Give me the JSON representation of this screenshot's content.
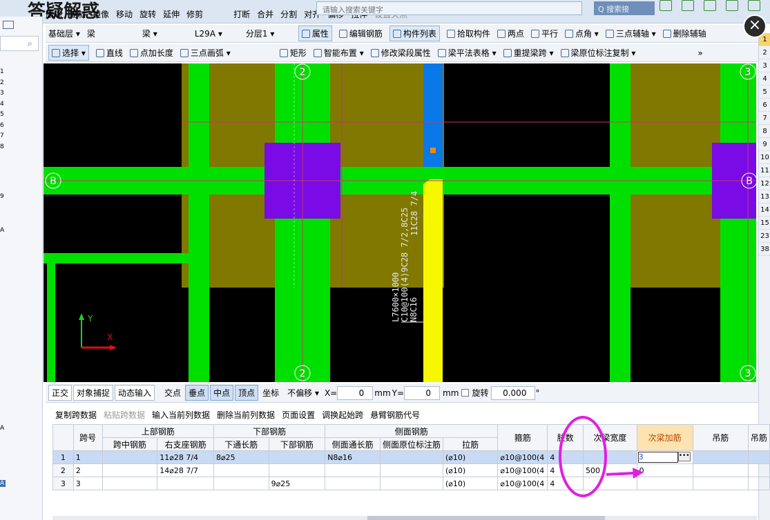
{
  "app": {
    "logo_text": "答疑解惑",
    "search_placeholder": "请输入搜索关键字",
    "search2_label": "Q 搜索接",
    "ribbon_items": [
      "删除",
      "复制",
      "镜像",
      "移动",
      "旋转",
      "延伸",
      "修剪",
      "打断",
      "合并",
      "分割",
      "对齐",
      "偏移",
      "拉伸",
      "设置夹点"
    ]
  },
  "left_panel": {
    "numbers": [
      "1",
      "2",
      "3",
      "4",
      "5",
      "6",
      "7",
      "8",
      "9",
      "A",
      "A",
      "A"
    ]
  },
  "right_panel": {
    "numbers": [
      "1",
      "2",
      "3",
      "4",
      "5",
      "6",
      "7",
      "8",
      "9",
      "10",
      "11",
      "12",
      "13",
      "14",
      "15",
      "23",
      "38"
    ]
  },
  "toolbar1": {
    "floor": "基础层",
    "type1": "梁",
    "type2": "梁",
    "element": "L29A",
    "layer": "分层1",
    "properties": "属性",
    "edit_rebar": "编辑钢筋",
    "component_list": "构件列表",
    "pick_component": "拾取构件",
    "two_points": "两点",
    "parallel": "平行",
    "point_angle": "点角",
    "three_point_axis": "三点辅轴",
    "delete_axis": "删除辅轴"
  },
  "toolbar2": {
    "select": "选择",
    "line": "直线",
    "point_length": "点加长度",
    "arc": "三点画弧",
    "rect": "矩形",
    "smart_layout": "智能布置",
    "modify_span": "修改梁段属性",
    "beam_table": "梁平法表格",
    "re_span": "重提梁跨",
    "copy_annot": "梁原位标注复制",
    "more": "»"
  },
  "canvas": {
    "axis_labels": [
      "2",
      "3",
      "B",
      "B",
      "2",
      "3"
    ],
    "annot_vertical1": "L7600×1000",
    "annot_vertical2": "C10@100(4)9C28 7/2,8C25",
    "annot_vertical3": "N8C16",
    "annot_vertical4": "11C28 7/4",
    "y_label": "Y",
    "x_label": "X",
    "colors": {
      "slab": "#807800",
      "beam": "#00e000",
      "column": "#7a0ae6",
      "selected_beam": "#f7f700",
      "blue_beam": "#0a78e6"
    }
  },
  "close_icon": "×",
  "snapbar": {
    "ortho": "正交",
    "snap": "对象捕捉",
    "dynamic": "动态输入",
    "intersect": "交点",
    "perpendicular": "垂点",
    "midpoint": "中点",
    "vertex": "顶点",
    "coordinate": "坐标",
    "offset": "不偏移",
    "x_label": "X=",
    "x_value": "0",
    "unit1": "mm",
    "y_label": "Y=",
    "y_value": "0",
    "unit2": "mm",
    "rotate": "旋转",
    "rotate_value": "0.000",
    "degree": "°"
  },
  "grid_toolbar": {
    "copy_span": "复制跨数据",
    "paste_span": "粘贴跨数据",
    "input_col": "输入当前列数据",
    "delete_col": "删除当前列数据",
    "page_setup": "页面设置",
    "swap_start": "调换起始跨",
    "cantilever": "悬臂钢筋代号"
  },
  "grid": {
    "group_headers": {
      "top": "上部钢筋",
      "bottom": "下部钢筋",
      "side": "侧面钢筋"
    },
    "headers": {
      "span_no": "跨号",
      "mid_span": "跨中钢筋",
      "right_support": "右支座钢筋",
      "bottom_through": "下通长筋",
      "bottom_bar": "下部钢筋",
      "side_through": "侧面通长筋",
      "side_orig": "侧面原位标注筋",
      "tie": "拉筋",
      "stirrup": "箍筋",
      "legs": "肢数",
      "sec_width": "次梁宽度",
      "sec_add": "次梁加筋",
      "hanger": "吊筋",
      "hanger2": "吊筋"
    },
    "rows": [
      {
        "rn": "1",
        "span": "1",
        "mid": "",
        "right": "11⌀28 7/4",
        "btm_through": "8⌀25",
        "btm": "",
        "side_through": "N8⌀16",
        "side_orig": "",
        "tie": "(⌀10)",
        "stirrup": "⌀10@100(4",
        "legs": "4",
        "sec_width": "",
        "sec_add": "3",
        "hanger": "",
        "hanger2": ""
      },
      {
        "rn": "2",
        "span": "2",
        "mid": "",
        "right": "14⌀28 7/7",
        "btm_through": "",
        "btm": "",
        "side_through": "",
        "side_orig": "",
        "tie": "(⌀10)",
        "stirrup": "⌀10@100(4",
        "legs": "4",
        "sec_width": "500",
        "sec_add": "0",
        "hanger": "",
        "hanger2": ""
      },
      {
        "rn": "3",
        "span": "3",
        "mid": "",
        "right": "",
        "btm_through": "",
        "btm": "9⌀25",
        "side_through": "",
        "side_orig": "",
        "tie": "(⌀10)",
        "stirrup": "⌀10@100(4",
        "legs": "4",
        "sec_width": "",
        "sec_add": "",
        "hanger": "",
        "hanger2": ""
      }
    ]
  }
}
